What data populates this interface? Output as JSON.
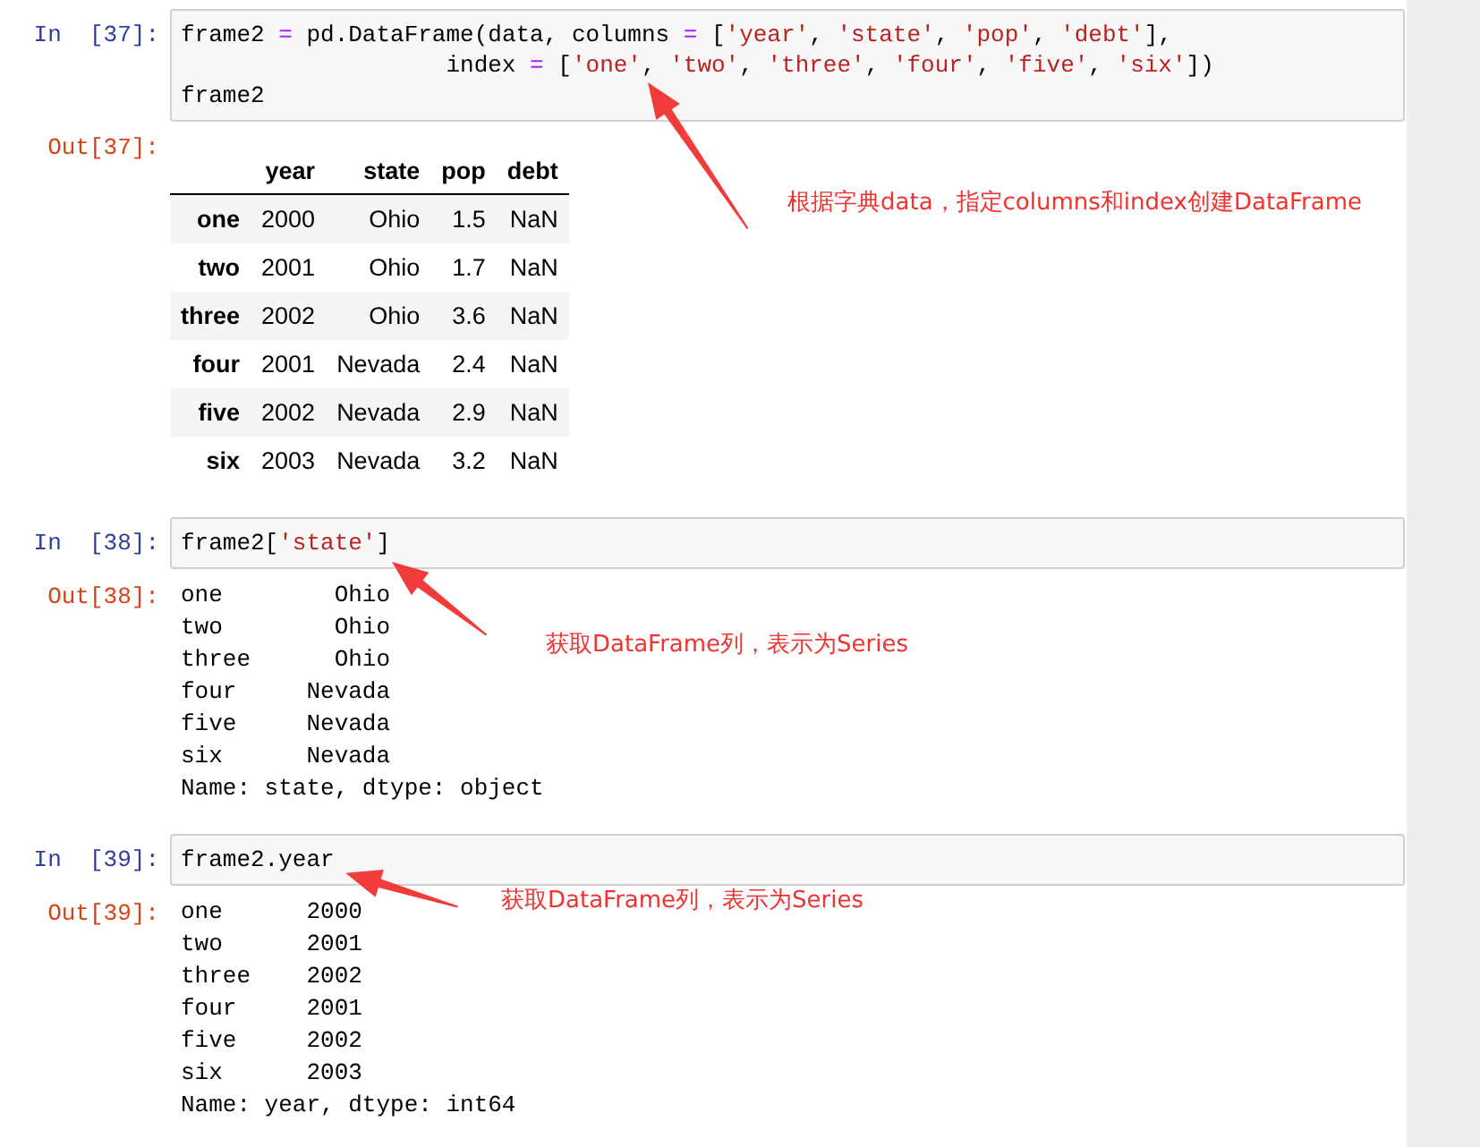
{
  "cells": [
    {
      "kind": "table",
      "in_prompt": "In  [37]:",
      "code": [
        [
          {
            "text": "frame2 ",
            "kind": "plain"
          },
          {
            "text": "=",
            "kind": "operator"
          },
          {
            "text": " pd.DataFrame(data, columns ",
            "kind": "plain"
          },
          {
            "text": "=",
            "kind": "operator"
          },
          {
            "text": " [",
            "kind": "plain"
          },
          {
            "text": "'year'",
            "kind": "string"
          },
          {
            "text": ", ",
            "kind": "plain"
          },
          {
            "text": "'state'",
            "kind": "string"
          },
          {
            "text": ", ",
            "kind": "plain"
          },
          {
            "text": "'pop'",
            "kind": "string"
          },
          {
            "text": ", ",
            "kind": "plain"
          },
          {
            "text": "'debt'",
            "kind": "string"
          },
          {
            "text": "],",
            "kind": "plain"
          }
        ],
        [
          {
            "text": "                   index ",
            "kind": "plain"
          },
          {
            "text": "=",
            "kind": "operator"
          },
          {
            "text": " [",
            "kind": "plain"
          },
          {
            "text": "'one'",
            "kind": "string"
          },
          {
            "text": ", ",
            "kind": "plain"
          },
          {
            "text": "'two'",
            "kind": "string"
          },
          {
            "text": ", ",
            "kind": "plain"
          },
          {
            "text": "'three'",
            "kind": "string"
          },
          {
            "text": ", ",
            "kind": "plain"
          },
          {
            "text": "'four'",
            "kind": "string"
          },
          {
            "text": ", ",
            "kind": "plain"
          },
          {
            "text": "'five'",
            "kind": "string"
          },
          {
            "text": ", ",
            "kind": "plain"
          },
          {
            "text": "'six'",
            "kind": "string"
          },
          {
            "text": "])",
            "kind": "plain"
          }
        ],
        [
          {
            "text": "frame2",
            "kind": "plain"
          }
        ]
      ],
      "out_prompt": "Out[37]:",
      "table": {
        "columns": [
          "year",
          "state",
          "pop",
          "debt"
        ],
        "rows": [
          {
            "index": "one",
            "cells": [
              "2000",
              "Ohio",
              "1.5",
              "NaN"
            ]
          },
          {
            "index": "two",
            "cells": [
              "2001",
              "Ohio",
              "1.7",
              "NaN"
            ]
          },
          {
            "index": "three",
            "cells": [
              "2002",
              "Ohio",
              "3.6",
              "NaN"
            ]
          },
          {
            "index": "four",
            "cells": [
              "2001",
              "Nevada",
              "2.4",
              "NaN"
            ]
          },
          {
            "index": "five",
            "cells": [
              "2002",
              "Nevada",
              "2.9",
              "NaN"
            ]
          },
          {
            "index": "six",
            "cells": [
              "2003",
              "Nevada",
              "3.2",
              "NaN"
            ]
          }
        ]
      },
      "annotation": "根据字典data，指定columns和index创建DataFrame"
    },
    {
      "kind": "text",
      "in_prompt": "In  [38]:",
      "code": [
        [
          {
            "text": "frame2[",
            "kind": "plain"
          },
          {
            "text": "'state'",
            "kind": "string"
          },
          {
            "text": "]",
            "kind": "plain"
          }
        ]
      ],
      "out_prompt": "Out[38]:",
      "output": [
        "one        Ohio",
        "two        Ohio",
        "three      Ohio",
        "four     Nevada",
        "five     Nevada",
        "six      Nevada",
        "Name: state, dtype: object"
      ],
      "annotation": "获取DataFrame列，表示为Series"
    },
    {
      "kind": "text",
      "in_prompt": "In  [39]:",
      "code": [
        [
          {
            "text": "frame2.year",
            "kind": "plain"
          }
        ]
      ],
      "out_prompt": "Out[39]:",
      "output": [
        "one      2000",
        "two      2001",
        "three    2002",
        "four     2001",
        "five     2002",
        "six      2003",
        "Name: year, dtype: int64"
      ],
      "annotation": "获取DataFrame列，表示为Series"
    }
  ]
}
